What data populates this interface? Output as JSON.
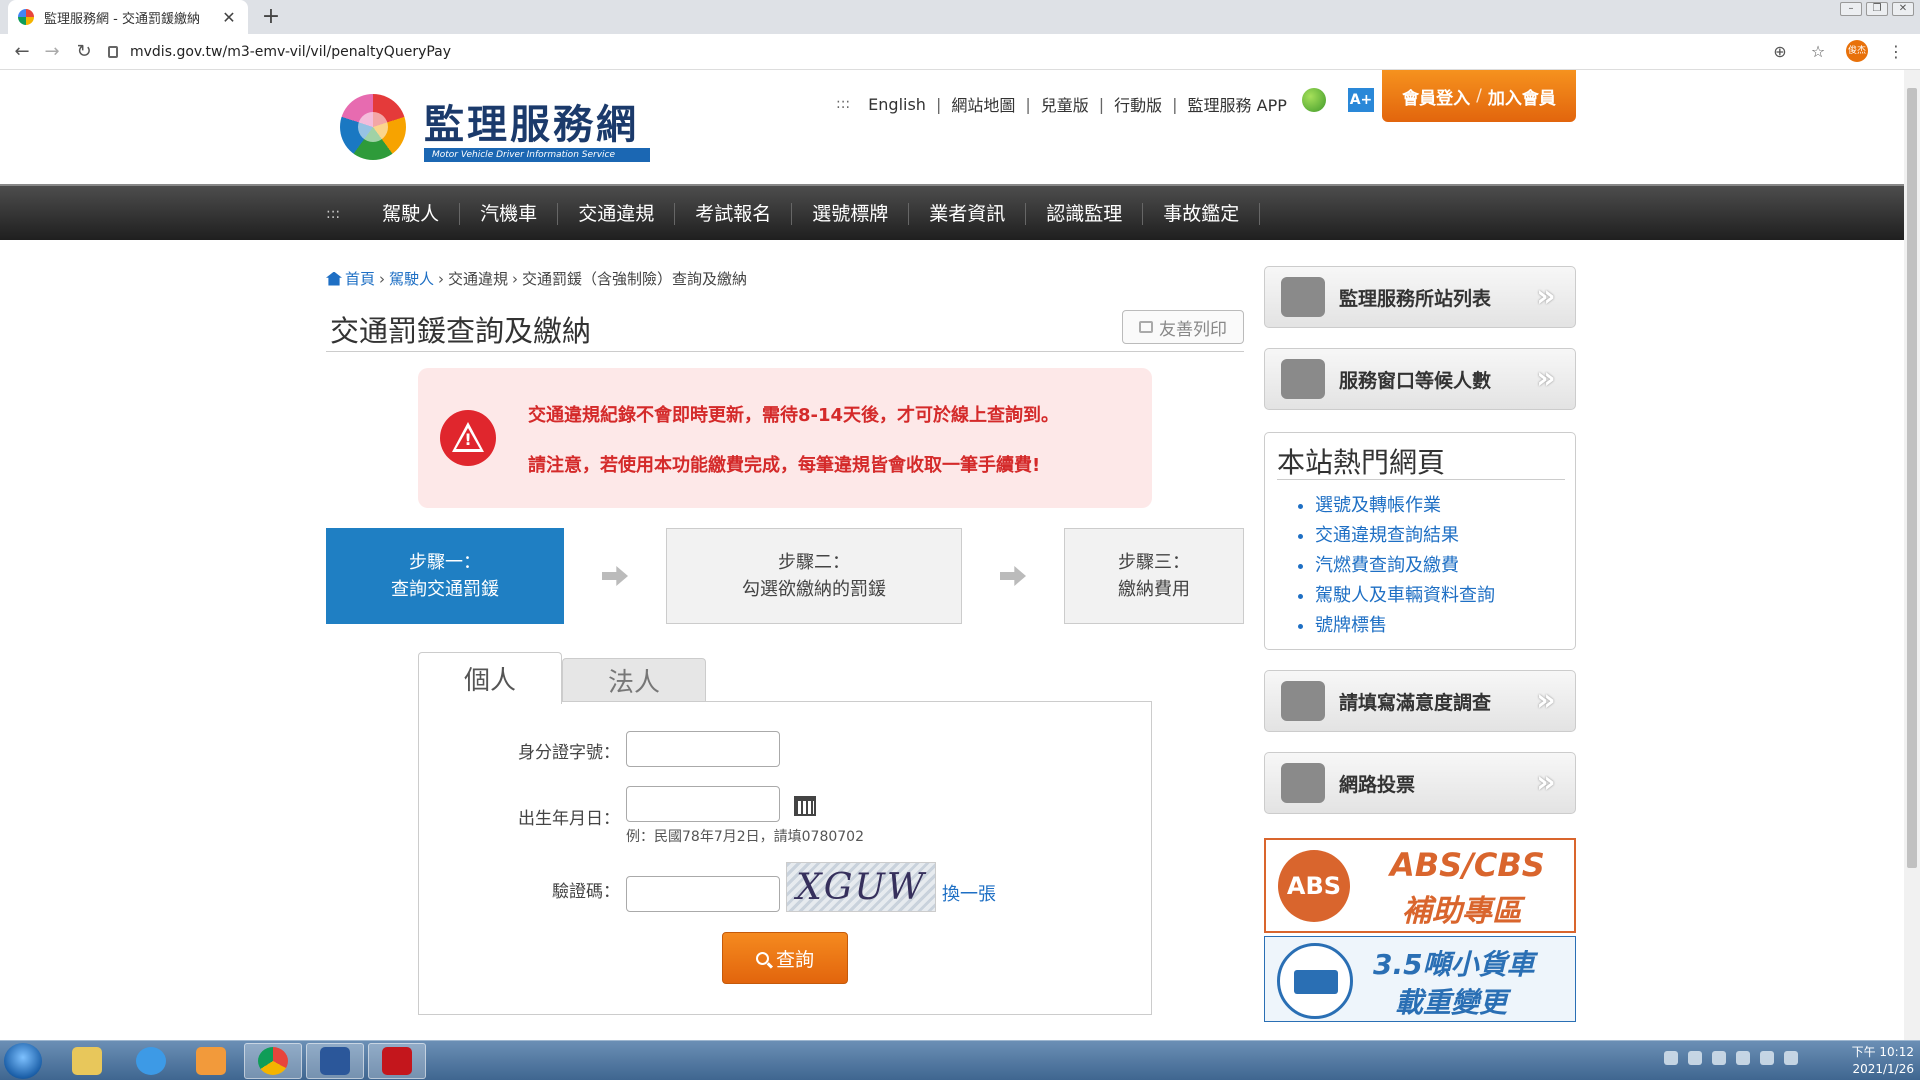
{
  "browser": {
    "tab_title": "監理服務網 - 交通罰鍰繳納",
    "tab_close": "✕",
    "new_tab": "+",
    "url": "mvdis.gov.tw/m3-emv-vil/vil/penaltyQueryPay",
    "profile_initials": "俊杰"
  },
  "header": {
    "logo_title": "監理服務網",
    "logo_subtitle": "Motor Vehicle Driver Information Service",
    "grip": ":::",
    "top_links": [
      "English",
      "網站地圖",
      "兒童版",
      "行動版",
      "監理服務 APP"
    ],
    "link_sep": "|",
    "member_login": "會員登入",
    "member_slash": "/",
    "member_join": "加入會員"
  },
  "menu": {
    "grip": ":::",
    "items": [
      "駕駛人",
      "汽機車",
      "交通違規",
      "考試報名",
      "選號標牌",
      "業者資訊",
      "認識監理",
      "事故鑑定"
    ]
  },
  "breadcrumb": {
    "items": [
      "首頁",
      "駕駛人",
      "交通違規",
      "交通罰鍰（含強制險）查詢及繳納"
    ],
    "sep": "›"
  },
  "page": {
    "title": "交通罰鍰查詢及繳納",
    "print_label": "友善列印"
  },
  "alert": {
    "symbol": "!",
    "line1": "交通違規紀錄不會即時更新，需待8-14天後，才可於線上查詢到。",
    "line2": "請注意，若使用本功能繳費完成，每筆違規皆會收取一筆手續費!"
  },
  "steps": [
    {
      "title": "步驟一：",
      "desc": "查詢交通罰鍰"
    },
    {
      "title": "步驟二：",
      "desc": "勾選欲繳納的罰鍰"
    },
    {
      "title": "步驟三：",
      "desc": "繳納費用"
    }
  ],
  "form": {
    "tabs": [
      "個人",
      "法人"
    ],
    "id_label": "身分證字號：",
    "id_value": "",
    "birth_label": "出生年月日：",
    "birth_value": "",
    "birth_hint": "例：民國78年7月2日，請填0780702",
    "captcha_label": "驗證碼：",
    "captcha_value": "",
    "captcha_image_text": "XGUW",
    "refresh_label": "換一張",
    "submit_label": "查詢"
  },
  "sidebar": {
    "station_list": "監理服務所站列表",
    "queue": "服務窗口等候人數",
    "hot_title": "本站熱門網頁",
    "hot_links": [
      "選號及轉帳作業",
      "交通違規查詢結果",
      "汽燃費查詢及繳費",
      "駕駛人及車輛資料查詢",
      "號牌標售"
    ],
    "survey": "請填寫滿意度調查",
    "vote": "網路投票",
    "chev": "»",
    "banner_abs_badge": "ABS",
    "banner_abs_line1": "ABS/CBS",
    "banner_abs_line2": "補助專區",
    "banner_truck_line1": "3.5噸小貨車",
    "banner_truck_line2": "載重變更"
  },
  "taskbar": {
    "time": "下午 10:12",
    "date": "2021/1/26"
  },
  "colors": {
    "accent_blue": "#1f7fc3",
    "orange": "#e2650d",
    "alert_red": "#d42a2a",
    "link_blue": "#1e6fc4"
  }
}
